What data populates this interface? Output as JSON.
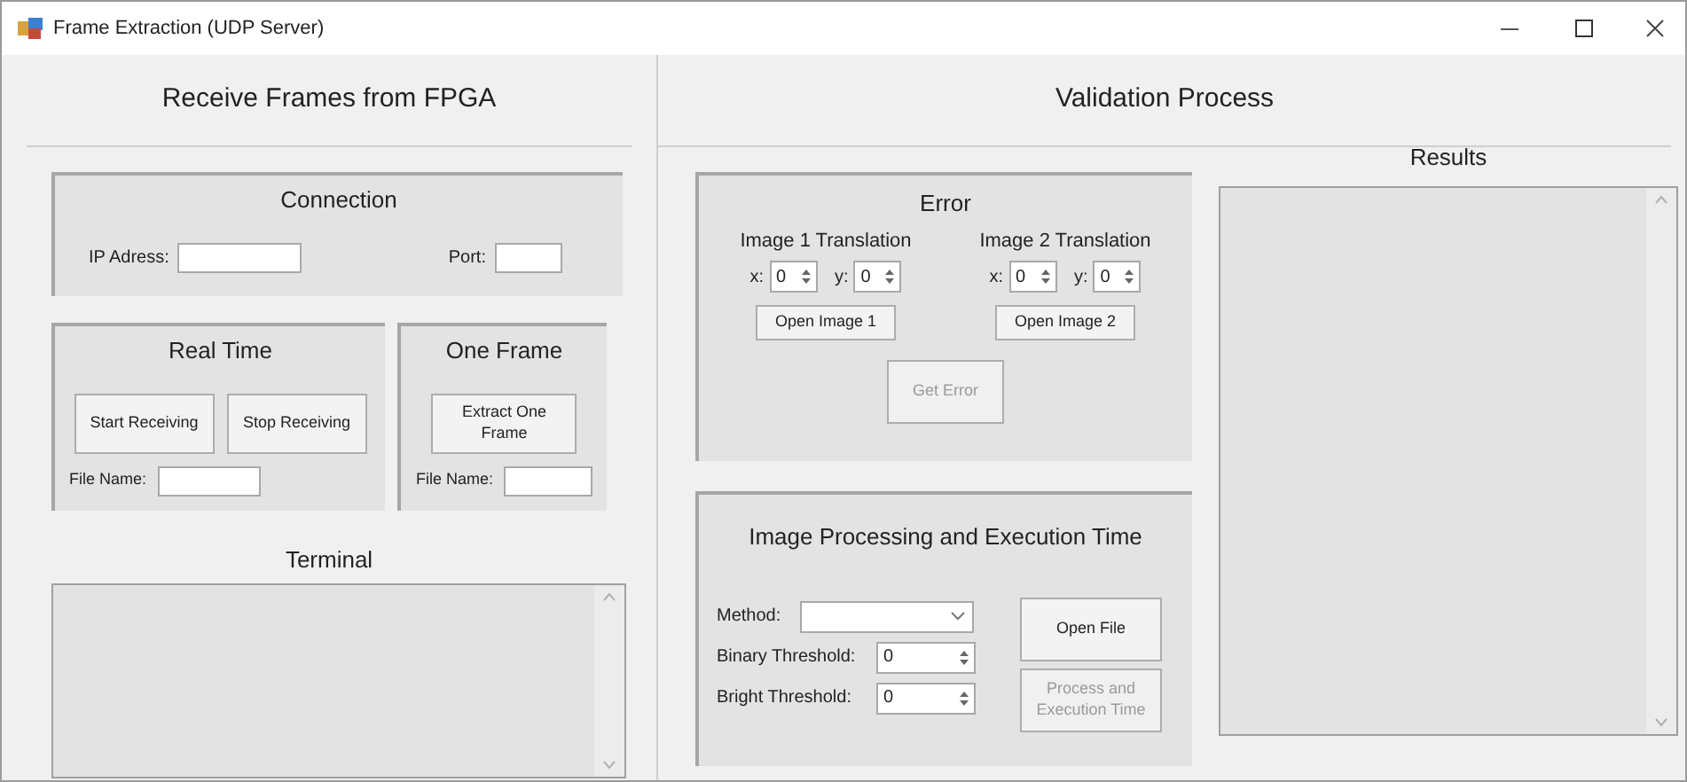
{
  "window": {
    "title": "Frame Extraction (UDP Server)"
  },
  "receive": {
    "heading": "Receive Frames from FPGA",
    "connection": {
      "title": "Connection",
      "fields": [
        {
          "label": "IP Adress:"
        },
        {
          "label": "Port:"
        }
      ]
    },
    "real_time": {
      "title": "Real Time",
      "buttons": [
        {
          "label": "Start Receiving",
          "disabled": false
        },
        {
          "label": "Stop Receiving",
          "disabled": false
        }
      ],
      "file_label": "File Name:"
    },
    "one_frame": {
      "title": "One Frame",
      "buttons": [
        {
          "label": "Extract One Frame",
          "disabled": false
        }
      ],
      "file_label": "File Name:"
    },
    "terminal": {
      "label": "Terminal"
    }
  },
  "validation": {
    "heading": "Validation Process",
    "error": {
      "title": "Error",
      "images": [
        {
          "title": "Image 1 Translation",
          "coords": [
            {
              "label": "x:",
              "value": "0"
            },
            {
              "label": "y:",
              "value": "0"
            }
          ],
          "button": {
            "label": "Open Image 1",
            "disabled": false
          }
        },
        {
          "title": "Image 2 Translation",
          "coords": [
            {
              "label": "x:",
              "value": "0"
            },
            {
              "label": "y:",
              "value": "0"
            }
          ],
          "button": {
            "label": "Open Image 2",
            "disabled": false
          }
        }
      ],
      "button": {
        "label": "Get Error",
        "disabled": true
      }
    },
    "processing": {
      "title": "Image Processing and Execution Time",
      "method_label": "Method:",
      "spinners": [
        {
          "label": "Binary Threshold:",
          "value": "0"
        },
        {
          "label": "Bright Threshold:",
          "value": "0"
        }
      ],
      "buttons": [
        {
          "label": "Open File",
          "disabled": false
        },
        {
          "label": "Process and Execution Time",
          "disabled": true
        }
      ]
    },
    "results": {
      "label": "Results"
    }
  }
}
